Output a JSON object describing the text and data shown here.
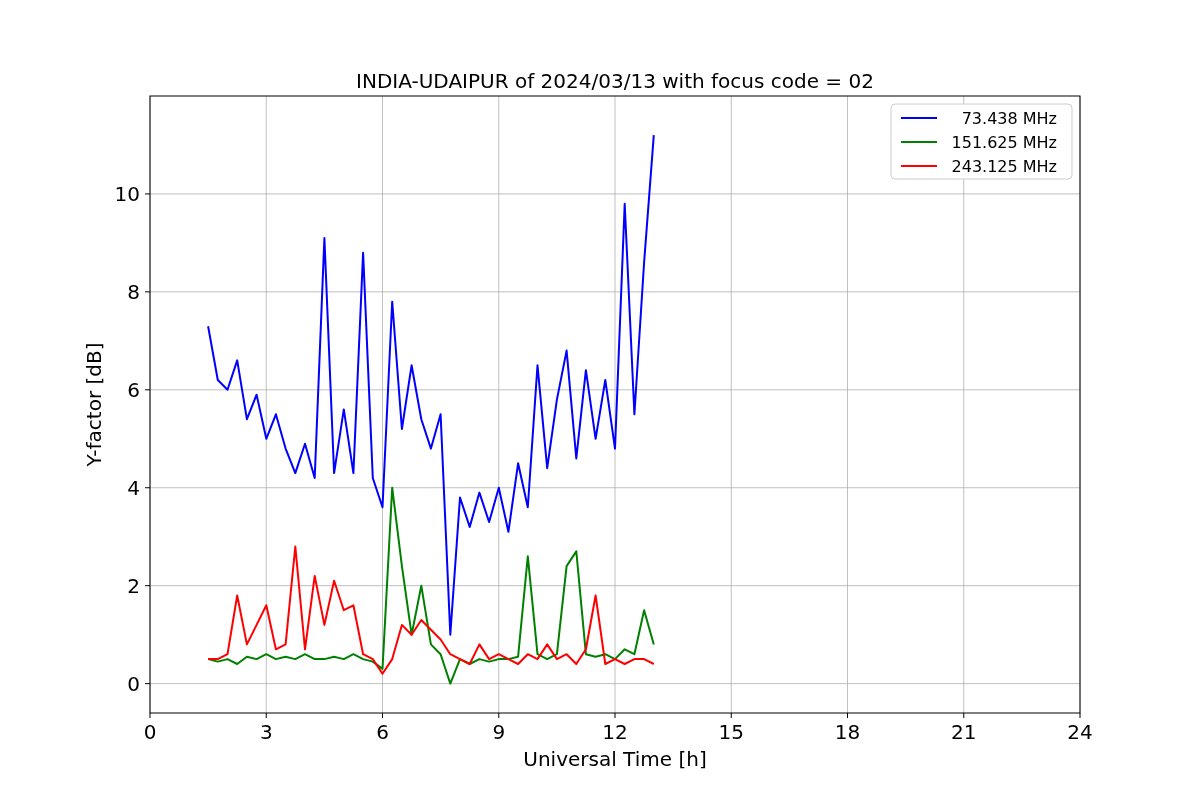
{
  "chart_data": {
    "type": "line",
    "title": "INDIA-UDAIPUR of 2024/03/13 with focus code = 02",
    "xlabel": "Universal Time [h]",
    "ylabel": "Y-factor [dB]",
    "xlim": [
      0,
      24
    ],
    "ylim": [
      -0.6,
      12
    ],
    "xticks": [
      0,
      3,
      6,
      9,
      12,
      15,
      18,
      21,
      24
    ],
    "yticks": [
      0,
      2,
      4,
      6,
      8,
      10
    ],
    "grid": true,
    "legend": true,
    "x": [
      1.5,
      1.75,
      2,
      2.25,
      2.5,
      2.75,
      3,
      3.25,
      3.5,
      3.75,
      4,
      4.25,
      4.5,
      4.75,
      5,
      5.25,
      5.5,
      5.75,
      6,
      6.25,
      6.5,
      6.75,
      7,
      7.25,
      7.5,
      7.75,
      8,
      8.25,
      8.5,
      8.75,
      9,
      9.25,
      9.5,
      9.75,
      10,
      10.25,
      10.5,
      10.75,
      11,
      11.25,
      11.5,
      11.75,
      12,
      12.25,
      12.5,
      12.75,
      13
    ],
    "series": [
      {
        "name": "73.438 MHz",
        "color": "#0000ff",
        "values": [
          7.3,
          6.2,
          6.0,
          6.6,
          5.4,
          5.9,
          5.0,
          5.5,
          4.8,
          4.3,
          4.9,
          4.2,
          9.1,
          4.3,
          5.6,
          4.3,
          8.8,
          4.2,
          3.6,
          7.8,
          5.2,
          6.5,
          5.4,
          4.8,
          5.5,
          1.0,
          3.8,
          3.2,
          3.9,
          3.3,
          4.0,
          3.1,
          4.5,
          3.6,
          6.5,
          4.4,
          5.8,
          6.8,
          4.6,
          6.4,
          5.0,
          6.2,
          4.8,
          9.8,
          5.5,
          8.6,
          11.2
        ]
      },
      {
        "name": "151.625 MHz",
        "color": "#008000",
        "values": [
          0.5,
          0.45,
          0.5,
          0.4,
          0.55,
          0.5,
          0.6,
          0.5,
          0.55,
          0.5,
          0.6,
          0.5,
          0.5,
          0.55,
          0.5,
          0.6,
          0.5,
          0.45,
          0.3,
          4.0,
          2.4,
          1.0,
          2.0,
          0.8,
          0.6,
          0.0,
          0.5,
          0.4,
          0.5,
          0.45,
          0.5,
          0.5,
          0.55,
          2.6,
          0.6,
          0.5,
          0.6,
          2.4,
          2.7,
          0.6,
          0.55,
          0.6,
          0.5,
          0.7,
          0.6,
          1.5,
          0.8
        ]
      },
      {
        "name": "243.125 MHz",
        "color": "#ff0000",
        "values": [
          0.5,
          0.5,
          0.6,
          1.8,
          0.8,
          1.2,
          1.6,
          0.7,
          0.8,
          2.8,
          0.7,
          2.2,
          1.2,
          2.1,
          1.5,
          1.6,
          0.6,
          0.5,
          0.2,
          0.5,
          1.2,
          1.0,
          1.3,
          1.1,
          0.9,
          0.6,
          0.5,
          0.4,
          0.8,
          0.5,
          0.6,
          0.5,
          0.4,
          0.6,
          0.5,
          0.8,
          0.5,
          0.6,
          0.4,
          0.7,
          1.8,
          0.4,
          0.5,
          0.4,
          0.5,
          0.5,
          0.4
        ]
      }
    ]
  }
}
